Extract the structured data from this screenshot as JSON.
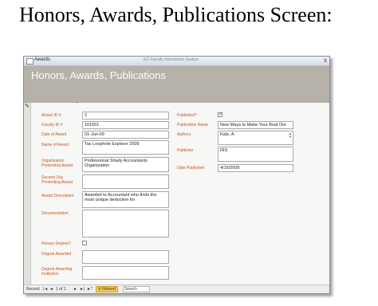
{
  "page": {
    "heading": "Honors, Awards, Publications Screen:"
  },
  "window": {
    "tab_label": "Awards",
    "app_title": "EO Faculty Information System",
    "close_glyph": "x",
    "form_title": "Honors, Awards, Publications"
  },
  "fields": {
    "award_id": {
      "label": "Award ID #",
      "value": "2"
    },
    "faculty_id": {
      "label": "Faculty ID #",
      "value": "101501"
    },
    "date_of_award": {
      "label": "Date of Award",
      "value": "01-Jun-09"
    },
    "name_of_award": {
      "label": "Name of Award",
      "value": "Tax Loophole Explorer 2009"
    },
    "org_presenting": {
      "label": "Organization Presenting Award",
      "value": "Professional Shady Accountants Organization"
    },
    "second_org": {
      "label": "Second Org Presenting Award",
      "value": ""
    },
    "award_description": {
      "label": "Award Description",
      "value": "Awarded to Accountant who finds the most unique deduction for"
    },
    "documentation": {
      "label": "Documentation",
      "value": ""
    },
    "honary_degree": {
      "label": "Honary Degree?",
      "checked": false
    },
    "degree_awarded": {
      "label": "Degree Awarded",
      "value": ""
    },
    "degree_institution": {
      "label": "Degree Awarding Institution",
      "value": ""
    },
    "published": {
      "label": "Published?",
      "checked": true
    },
    "publication_name": {
      "label": "Publication Name",
      "value": "New Ways to Make Your Boat Dre"
    },
    "authors": {
      "label": "Authors",
      "value": "Katz, A."
    },
    "publisher": {
      "label": "Publisher",
      "value": "IRS"
    },
    "date_published": {
      "label": "Date Published",
      "value": "4/15/2009"
    }
  },
  "navbar": {
    "record_label": "Record:",
    "first_glyph": "|◄",
    "prev_glyph": "◄",
    "position": "1 of 1",
    "next_glyph": "►",
    "last_glyph": "►|",
    "new_glyph": "►*",
    "filter_label": "Filtered",
    "search_label": "Search"
  },
  "icons": {
    "tab": "form-icon",
    "close": "close-icon",
    "record_selector": "pencil-icon",
    "cursor": "mouse-pointer-icon"
  },
  "colors": {
    "header_band": "#b6b2a9",
    "label_text": "#c4561a",
    "filter_badge": "#f2c94c"
  }
}
